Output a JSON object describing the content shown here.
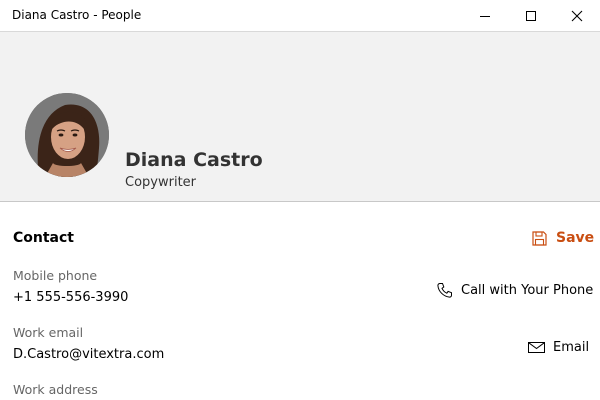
{
  "window": {
    "title": "Diana Castro - People"
  },
  "profile": {
    "name": "Diana Castro",
    "role": "Copywriter"
  },
  "contact": {
    "section_title": "Contact",
    "save_label": "Save",
    "fields": [
      {
        "label": "Mobile phone",
        "value": "+1 555-556-3990",
        "action_label": "Call with Your Phone",
        "action_icon": "phone-icon"
      },
      {
        "label": "Work email",
        "value": "D.Castro@vitextra.com",
        "action_label": "Email",
        "action_icon": "envelope-icon"
      },
      {
        "label": "Work address"
      }
    ]
  },
  "colors": {
    "accent": "#c94e12",
    "header_bg": "#f2f2f2",
    "label_gray": "#666666"
  }
}
